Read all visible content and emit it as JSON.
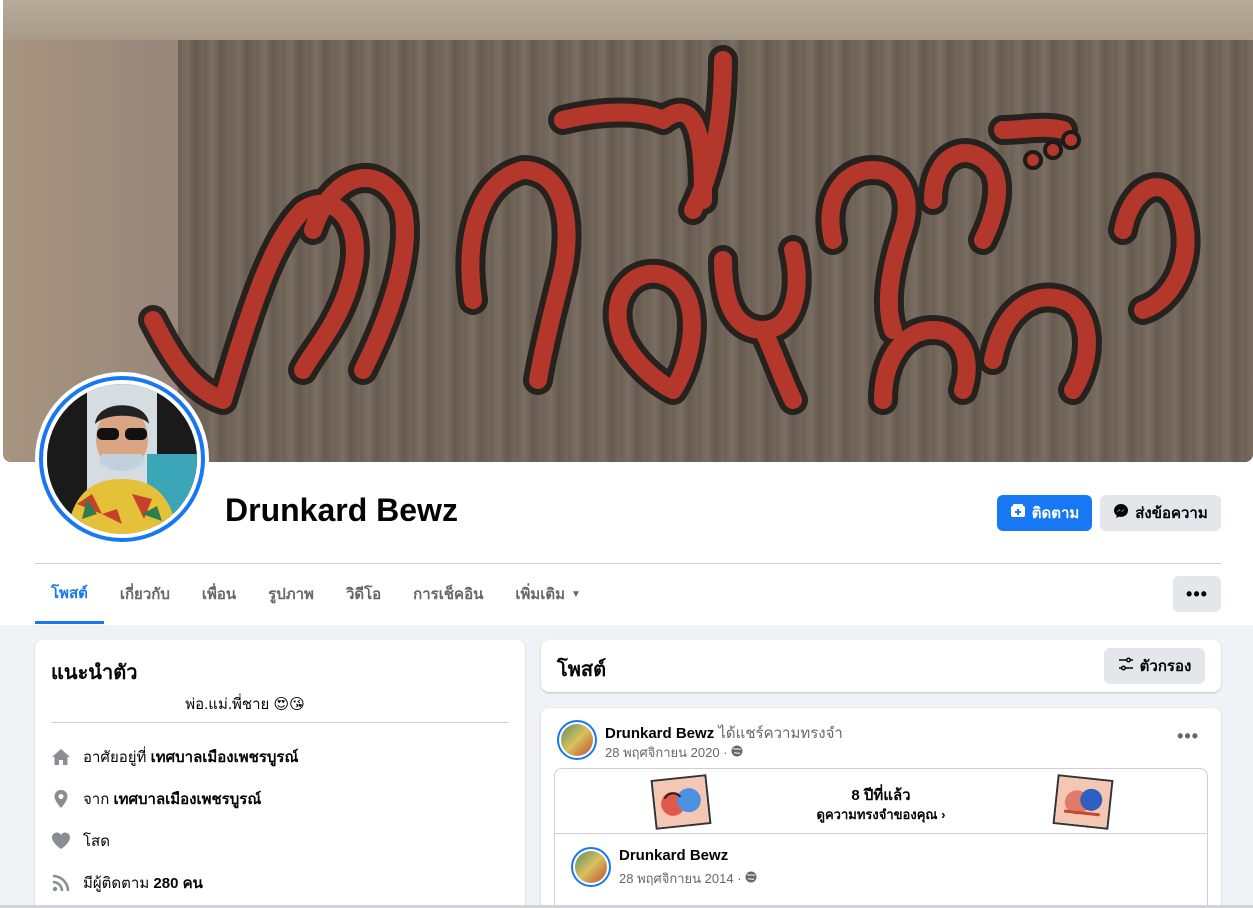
{
  "profile": {
    "name": "Drunkard Bewz",
    "follow_label": "ติดตาม",
    "message_label": "ส่งข้อความ",
    "more_label": "•••"
  },
  "tabs": [
    {
      "label": "โพสต์",
      "active": true
    },
    {
      "label": "เกี่ยวกับ"
    },
    {
      "label": "เพื่อน"
    },
    {
      "label": "รูปภาพ"
    },
    {
      "label": "วิดีโอ"
    },
    {
      "label": "การเช็คอิน"
    },
    {
      "label": "เพิ่มเติม"
    }
  ],
  "intro": {
    "title": "แนะนำตัว",
    "bio": "พ่อ.แม่.พี่ชาย 😍😘",
    "lives_prefix": "อาศัยอยู่ที่",
    "lives_place": "เทศบาลเมืองเพชรบูรณ์",
    "from_prefix": "จาก",
    "from_place": "เทศบาลเมืองเพชรบูรณ์",
    "relationship": "โสด",
    "followers_prefix": "มีผู้ติดตาม",
    "followers_count": "280 คน"
  },
  "posts": {
    "title": "โพสต์",
    "filter_label": "ตัวกรอง"
  },
  "post": {
    "author": "Drunkard Bewz",
    "action": "ได้แชร์ความทรงจำ",
    "date": "28 พฤศจิกายน 2020 ·",
    "memory_title": "8 ปีที่แล้ว",
    "memory_link": "ดูความทรงจำของคุณ",
    "inner_author": "Drunkard Bewz",
    "inner_date": "28 พฤศจิกายน 2014 ·"
  },
  "colors": {
    "accent": "#1877f2",
    "secondary_button": "#e4e6eb",
    "background": "#f0f2f5"
  }
}
